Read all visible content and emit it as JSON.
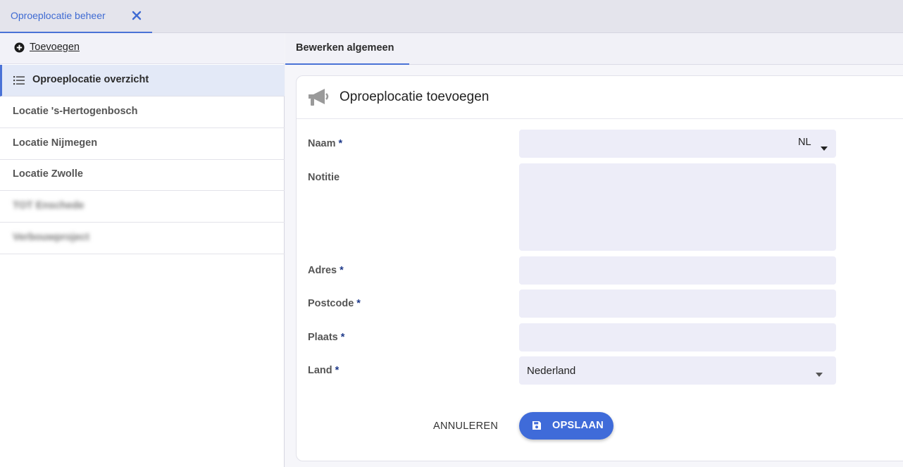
{
  "top_tab": {
    "label": "Oproeplocatie beheer",
    "close_icon": "close-icon"
  },
  "sidebar": {
    "add_label": "Toevoegen",
    "active_item": "Oproeplocatie overzicht",
    "items": [
      {
        "label": "Locatie 's-Hertogenbosch"
      },
      {
        "label": "Locatie Nijmegen"
      },
      {
        "label": "Locatie Zwolle"
      },
      {
        "label": "TOT Enschede"
      },
      {
        "label": "Verbouwproject"
      }
    ]
  },
  "main": {
    "subtab_label": "Bewerken algemeen",
    "card_title": "Oproeplocatie toevoegen",
    "fields": {
      "naam": {
        "label": "Naam",
        "required": "*",
        "value": "",
        "lang": "NL"
      },
      "notitie": {
        "label": "Notitie",
        "value": ""
      },
      "adres": {
        "label": "Adres",
        "required": "*",
        "value": ""
      },
      "postcode": {
        "label": "Postcode",
        "required": "*",
        "value": ""
      },
      "plaats": {
        "label": "Plaats",
        "required": "*",
        "value": ""
      },
      "land": {
        "label": "Land",
        "required": "*",
        "value": "Nederland"
      }
    },
    "cancel_label": "ANNULEREN",
    "save_label": "OPSLAAN"
  },
  "colors": {
    "accent": "#3f6bd9",
    "active_bg": "#e3e9f7",
    "input_bg": "#ededf8",
    "required_star": "#1f3a8a"
  }
}
